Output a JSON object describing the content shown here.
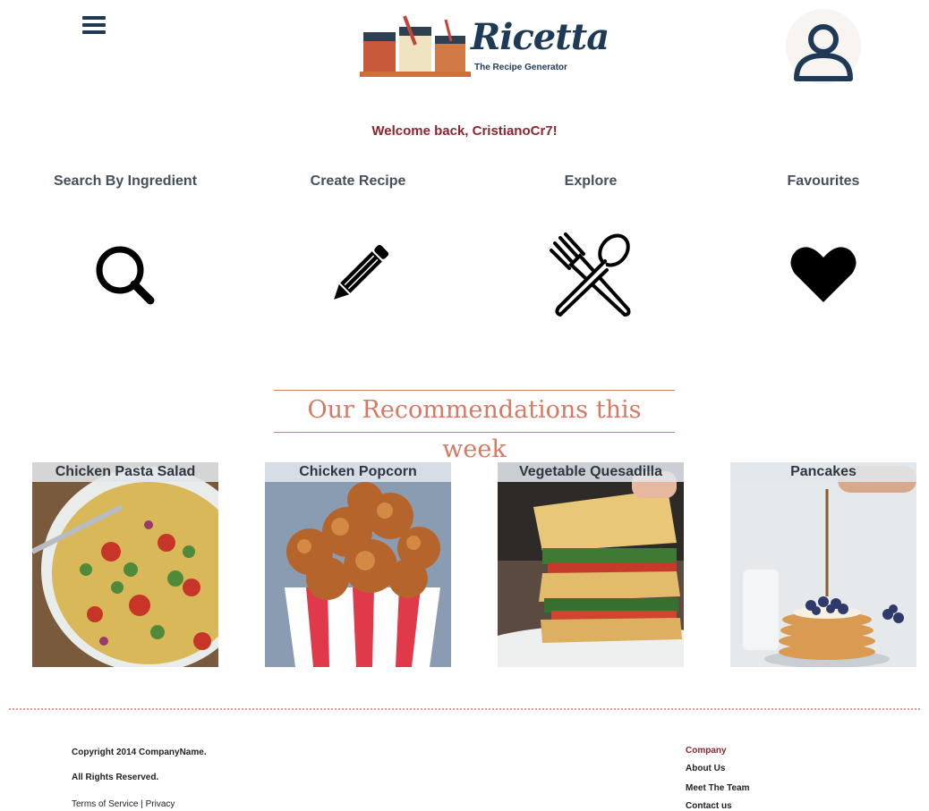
{
  "header": {
    "logo_title": "Ricetta",
    "logo_subtitle": "The Recipe Generator",
    "welcome": "Welcome back, CristianoCr7!"
  },
  "nav": [
    {
      "label": "Search By Ingredient",
      "icon": "search-icon"
    },
    {
      "label": "Create Recipe",
      "icon": "pencil-icon"
    },
    {
      "label": "Explore",
      "icon": "fork-spoon-icon"
    },
    {
      "label": "Favourites",
      "icon": "heart-icon"
    }
  ],
  "recommendations": {
    "title": "Our Recommendations this week",
    "cards": [
      {
        "label": "Chicken Pasta Salad"
      },
      {
        "label": "Chicken Popcorn"
      },
      {
        "label": "Vegetable Quesadilla"
      },
      {
        "label": "Pancakes"
      }
    ]
  },
  "footer": {
    "copyright": "Copyright 2014 CompanyName.",
    "rights": "All Rights Reserved.",
    "terms": "Terms of Service | Privacy",
    "company_heading": "Company",
    "links": [
      "About Us",
      "Meet The Team",
      "Contact us"
    ]
  },
  "colors": {
    "brand_navy": "#1f3a57",
    "accent_salmon": "#d47a64",
    "welcome_maroon": "#8a2630"
  }
}
